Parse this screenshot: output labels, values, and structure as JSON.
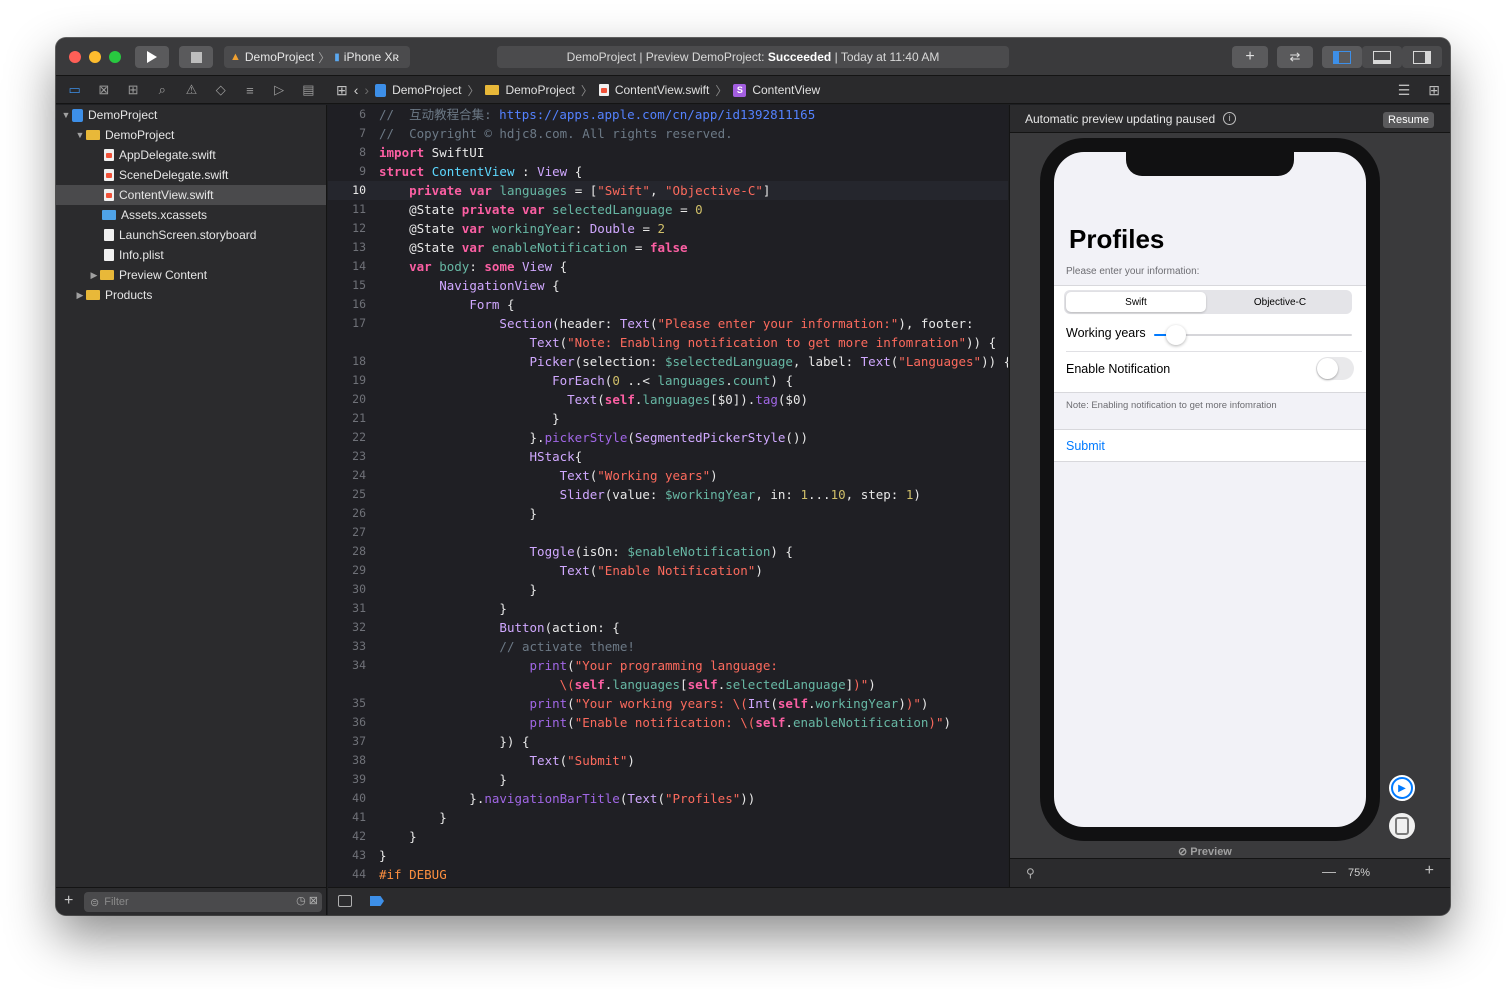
{
  "titlebar": {
    "scheme_project": "DemoProject",
    "scheme_device": "iPhone Xʀ",
    "activity_prefix": "DemoProject | Preview DemoProject:",
    "activity_status": "Succeeded",
    "activity_suffix": "| Today at 11:40 AM"
  },
  "jumpbar": {
    "items": [
      "DemoProject",
      "DemoProject",
      "ContentView.swift",
      "ContentView"
    ]
  },
  "navigator": {
    "rows": [
      {
        "label": "DemoProject",
        "kind": "project"
      },
      {
        "label": "DemoProject",
        "kind": "folder"
      },
      {
        "label": "AppDelegate.swift",
        "kind": "swift"
      },
      {
        "label": "SceneDelegate.swift",
        "kind": "swift"
      },
      {
        "label": "ContentView.swift",
        "kind": "swift"
      },
      {
        "label": "Assets.xcassets",
        "kind": "assets"
      },
      {
        "label": "LaunchScreen.storyboard",
        "kind": "file"
      },
      {
        "label": "Info.plist",
        "kind": "file"
      },
      {
        "label": "Preview Content",
        "kind": "folder"
      },
      {
        "label": "Products",
        "kind": "folder"
      }
    ],
    "filter_placeholder": "Filter"
  },
  "editor": {
    "current_line": 10,
    "lines": [
      {
        "n": "6",
        "html": "<span class=\"com\">//  互动教程合集: <span class=\"url\">https://apps.apple.com/cn/app/id1392811165</span></span>"
      },
      {
        "n": "7",
        "html": "<span class=\"com\">//  Copyright © hdjc8.com. All rights reserved.</span>"
      },
      {
        "n": "8",
        "html": "<span class=\"kw\">import</span> SwiftUI"
      },
      {
        "n": "9",
        "html": "<span class=\"kw\">struct</span> <span class=\"typb\">ContentView</span> : <span class=\"typ\">View</span> {"
      },
      {
        "n": "10",
        "html": "    <span class=\"kw\">private</span> <span class=\"kw\">var</span> <span class=\"prop\">languages</span> = [<span class=\"str\">\"Swift\"</span>, <span class=\"str\">\"Objective-C\"</span>]"
      },
      {
        "n": "11",
        "html": "    @State <span class=\"kw\">private</span> <span class=\"kw\">var</span> <span class=\"prop\">selectedLanguage</span> = <span class=\"num\">0</span>"
      },
      {
        "n": "12",
        "html": "    @State <span class=\"kw\">var</span> <span class=\"prop\">workingYear</span>: <span class=\"typ\">Double</span> = <span class=\"num\">2</span>"
      },
      {
        "n": "13",
        "html": "    @State <span class=\"kw\">var</span> <span class=\"prop\">enableNotification</span> = <span class=\"kw\">false</span>"
      },
      {
        "n": "14",
        "html": "    <span class=\"kw\">var</span> <span class=\"prop\">body</span>: <span class=\"kw\">some</span> <span class=\"typ\">View</span> {"
      },
      {
        "n": "15",
        "html": "        <span class=\"typ\">NavigationView</span> {"
      },
      {
        "n": "16",
        "html": "            <span class=\"typ\">Form</span> {"
      },
      {
        "n": "17",
        "html": "                <span class=\"typ\">Section</span>(header: <span class=\"typ\">Text</span>(<span class=\"str\">\"Please enter your information:\"</span>), footer:"
      },
      {
        "n": "",
        "html": "                    <span class=\"typ\">Text</span>(<span class=\"str\">\"Note: Enabling notification to get more infomration\"</span>)) {"
      },
      {
        "n": "18",
        "html": "                    <span class=\"typ\">Picker</span>(selection: <span class=\"prop\">$selectedLanguage</span>, label: <span class=\"typ\">Text</span>(<span class=\"str\">\"Languages\"</span>)) {"
      },
      {
        "n": "19",
        "html": "                       <span class=\"typ\">ForEach</span>(<span class=\"num\">0</span> ..&lt; <span class=\"prop\">languages</span>.<span class=\"prop\">count</span>) {"
      },
      {
        "n": "20",
        "html": "                         <span class=\"typ\">Text</span>(<span class=\"kw\">self</span>.<span class=\"prop\">languages</span>[$0]).<span class=\"fn\">tag</span>($0)"
      },
      {
        "n": "21",
        "html": "                       }"
      },
      {
        "n": "22",
        "html": "                    }.<span class=\"fn\">pickerStyle</span>(<span class=\"typ\">SegmentedPickerStyle</span>())"
      },
      {
        "n": "23",
        "html": "                    <span class=\"typ\">HStack</span>{"
      },
      {
        "n": "24",
        "html": "                        <span class=\"typ\">Text</span>(<span class=\"str\">\"Working years\"</span>)"
      },
      {
        "n": "25",
        "html": "                        <span class=\"typ\">Slider</span>(value: <span class=\"prop\">$workingYear</span>, in: <span class=\"num\">1</span>...<span class=\"num\">10</span>, step: <span class=\"num\">1</span>)"
      },
      {
        "n": "26",
        "html": "                    }"
      },
      {
        "n": "27",
        "html": ""
      },
      {
        "n": "28",
        "html": "                    <span class=\"typ\">Toggle</span>(isOn: <span class=\"prop\">$enableNotification</span>) {"
      },
      {
        "n": "29",
        "html": "                        <span class=\"typ\">Text</span>(<span class=\"str\">\"Enable Notification\"</span>)"
      },
      {
        "n": "30",
        "html": "                    }"
      },
      {
        "n": "31",
        "html": "                }"
      },
      {
        "n": "32",
        "html": "                <span class=\"typ\">Button</span>(action: {"
      },
      {
        "n": "33",
        "html": "                <span class=\"com\">// activate theme!</span>"
      },
      {
        "n": "34",
        "html": "                    <span class=\"fn\">print</span>(<span class=\"str\">\"Your programming language:</span>"
      },
      {
        "n": "",
        "html": "<span class=\"str\">                        \\(</span><span class=\"kw\">self</span>.<span class=\"prop\">languages</span>[<span class=\"kw\">self</span>.<span class=\"prop\">selectedLanguage</span>]<span class=\"str\">)\"</span>)"
      },
      {
        "n": "35",
        "html": "                    <span class=\"fn\">print</span>(<span class=\"str\">\"Your working years: \\(</span><span class=\"typ\">Int</span>(<span class=\"kw\">self</span>.<span class=\"prop\">workingYear</span>)<span class=\"str\">)\"</span>)"
      },
      {
        "n": "36",
        "html": "                    <span class=\"fn\">print</span>(<span class=\"str\">\"Enable notification: \\(</span><span class=\"kw\">self</span>.<span class=\"prop\">enableNotification</span><span class=\"str\">)\"</span>)"
      },
      {
        "n": "37",
        "html": "                }) {"
      },
      {
        "n": "38",
        "html": "                    <span class=\"typ\">Text</span>(<span class=\"str\">\"Submit\"</span>)"
      },
      {
        "n": "39",
        "html": "                }"
      },
      {
        "n": "40",
        "html": "            }.<span class=\"fn\">navigationBarTitle</span>(<span class=\"typ\">Text</span>(<span class=\"str\">\"Profiles\"</span>))"
      },
      {
        "n": "41",
        "html": "        }"
      },
      {
        "n": "42",
        "html": "    }"
      },
      {
        "n": "43",
        "html": "}"
      },
      {
        "n": "44",
        "html": "<span class=\"pp\">#if DEBUG</span>"
      }
    ]
  },
  "canvas": {
    "status": "Automatic preview updating paused",
    "resume_label": "Resume",
    "preview_label": "Preview",
    "zoom": "75%"
  },
  "app": {
    "title": "Profiles",
    "section_header": "Please enter your information:",
    "segments": [
      "Swift",
      "Objective-C"
    ],
    "selected_segment": 0,
    "working_years_label": "Working years",
    "slider": {
      "min": 1,
      "max": 10,
      "value": 2
    },
    "toggle_label": "Enable Notification",
    "toggle_on": false,
    "section_footer": "Note: Enabling notification to get more infomration",
    "submit_label": "Submit"
  }
}
